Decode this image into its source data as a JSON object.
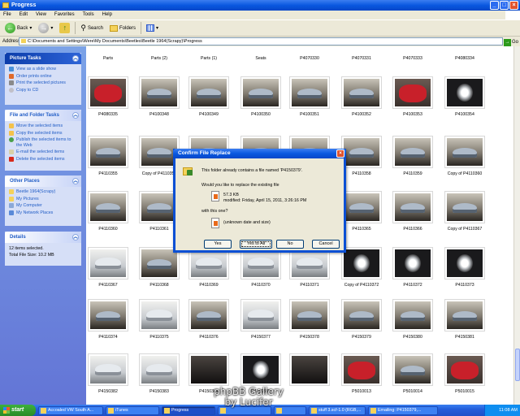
{
  "window": {
    "title": "Progress"
  },
  "menu": [
    "File",
    "Edit",
    "View",
    "Favorites",
    "Tools",
    "Help"
  ],
  "toolbar": {
    "back": "Back",
    "search": "Search",
    "folders": "Folders"
  },
  "address": {
    "label": "Address",
    "value": "C:\\Documents and Settings\\Were\\My Documents\\Beetles\\Beetle 1964(Scrapy)\\Progress",
    "go": "Go"
  },
  "sidebar": {
    "picture_tasks": {
      "title": "Picture Tasks",
      "items": [
        "View as a slide show",
        "Order prints online",
        "Print the selected pictures",
        "Copy to CD"
      ]
    },
    "file_tasks": {
      "title": "File and Folder Tasks",
      "items": [
        "Move the selected items",
        "Copy the selected items",
        "Publish the selected items to the Web",
        "E-mail the selected items",
        "Delete the selected items"
      ]
    },
    "other_places": {
      "title": "Other Places",
      "items": [
        "Beetle 1964(Scrapy)",
        "My Pictures",
        "My Computer",
        "My Network Places"
      ]
    },
    "details": {
      "title": "Details",
      "line1": "12 items selected.",
      "line2": "Total File Size: 10.2 MB"
    }
  },
  "files": [
    {
      "name": "Parts",
      "img": "dark"
    },
    {
      "name": "Parts (2)",
      "img": "dark"
    },
    {
      "name": "Parts (1)",
      "img": "dark"
    },
    {
      "name": "Seats",
      "img": "dark"
    },
    {
      "name": "P4070330",
      "img": "dark"
    },
    {
      "name": "P4070331",
      "img": "dark"
    },
    {
      "name": "P4070333",
      "img": "dark"
    },
    {
      "name": "P4080334",
      "img": "dark"
    },
    {
      "name": "P4080335",
      "img": "red"
    },
    {
      "name": "P4100348",
      "img": "car"
    },
    {
      "name": "P4100349",
      "img": "car"
    },
    {
      "name": "P4100350",
      "img": "car"
    },
    {
      "name": "P4100351",
      "img": "car"
    },
    {
      "name": "P4100352",
      "img": "car"
    },
    {
      "name": "P4100353",
      "img": "red"
    },
    {
      "name": "P4100354",
      "img": "wheel"
    },
    {
      "name": "P4110355",
      "img": "car"
    },
    {
      "name": "Copy of P4110358",
      "img": "car"
    },
    {
      "name": "",
      "img": "car"
    },
    {
      "name": "",
      "img": "car"
    },
    {
      "name": "",
      "img": "car"
    },
    {
      "name": "P4110358",
      "img": "car"
    },
    {
      "name": "P4110359",
      "img": "car"
    },
    {
      "name": "Copy of P4110360",
      "img": "car"
    },
    {
      "name": "P4110360",
      "img": "car"
    },
    {
      "name": "P4110361",
      "img": "car"
    },
    {
      "name": "",
      "img": "car"
    },
    {
      "name": "",
      "img": "car"
    },
    {
      "name": "",
      "img": "car"
    },
    {
      "name": "P4110365",
      "img": "car"
    },
    {
      "name": "P4110366",
      "img": "car"
    },
    {
      "name": "Copy of P4110367",
      "img": "car"
    },
    {
      "name": "P4110367",
      "img": "light"
    },
    {
      "name": "P4110368",
      "img": "car"
    },
    {
      "name": "P4110369",
      "img": "light"
    },
    {
      "name": "P4110370",
      "img": "light"
    },
    {
      "name": "P4110371",
      "img": "light"
    },
    {
      "name": "Copy of P4110372",
      "img": "wheel"
    },
    {
      "name": "P4110372",
      "img": "wheel"
    },
    {
      "name": "P4110373",
      "img": "wheel"
    },
    {
      "name": "P4110374",
      "img": "car"
    },
    {
      "name": "P4110375",
      "img": "light"
    },
    {
      "name": "P4110376",
      "img": "car"
    },
    {
      "name": "P4150377",
      "img": "light"
    },
    {
      "name": "P4150378",
      "img": "car"
    },
    {
      "name": "P4150379",
      "img": "car"
    },
    {
      "name": "P4150380",
      "img": "car"
    },
    {
      "name": "P4150381",
      "img": "car"
    },
    {
      "name": "P4150382",
      "img": "light"
    },
    {
      "name": "P4150383",
      "img": "light"
    },
    {
      "name": "P4150384",
      "img": "dark"
    },
    {
      "name": "P4150385",
      "img": "wheel"
    },
    {
      "name": "",
      "img": "dark"
    },
    {
      "name": "P5010013",
      "img": "red"
    },
    {
      "name": "P5010014",
      "img": "car"
    },
    {
      "name": "P5010015",
      "img": "red"
    }
  ],
  "dialog": {
    "title": "Confirm File Replace",
    "message": "This folder already contains a file named 'P4150379'.",
    "question": "Would you like to replace the existing file",
    "existing_size": "57.3 KB",
    "existing_modified": "modified: Friday, April 15, 2011, 3:26:16 PM",
    "with_this": "with this one?",
    "new_info": "(unknown date and size)",
    "buttons": {
      "yes": "Yes",
      "yes_all": "Yes to All",
      "no": "No",
      "cancel": "Cancel"
    }
  },
  "taskbar": {
    "start": "start",
    "tasks": [
      "Accoaled VW South A...",
      "iTunes",
      "Progress",
      "",
      "",
      "stuff 3.scf-1.0 (RGB,...",
      "Emailing: P4150379,..."
    ],
    "clock": "11:08 AM"
  },
  "watermark": {
    "line1": "phpBB Gallery",
    "line2": "by Lucifer"
  }
}
